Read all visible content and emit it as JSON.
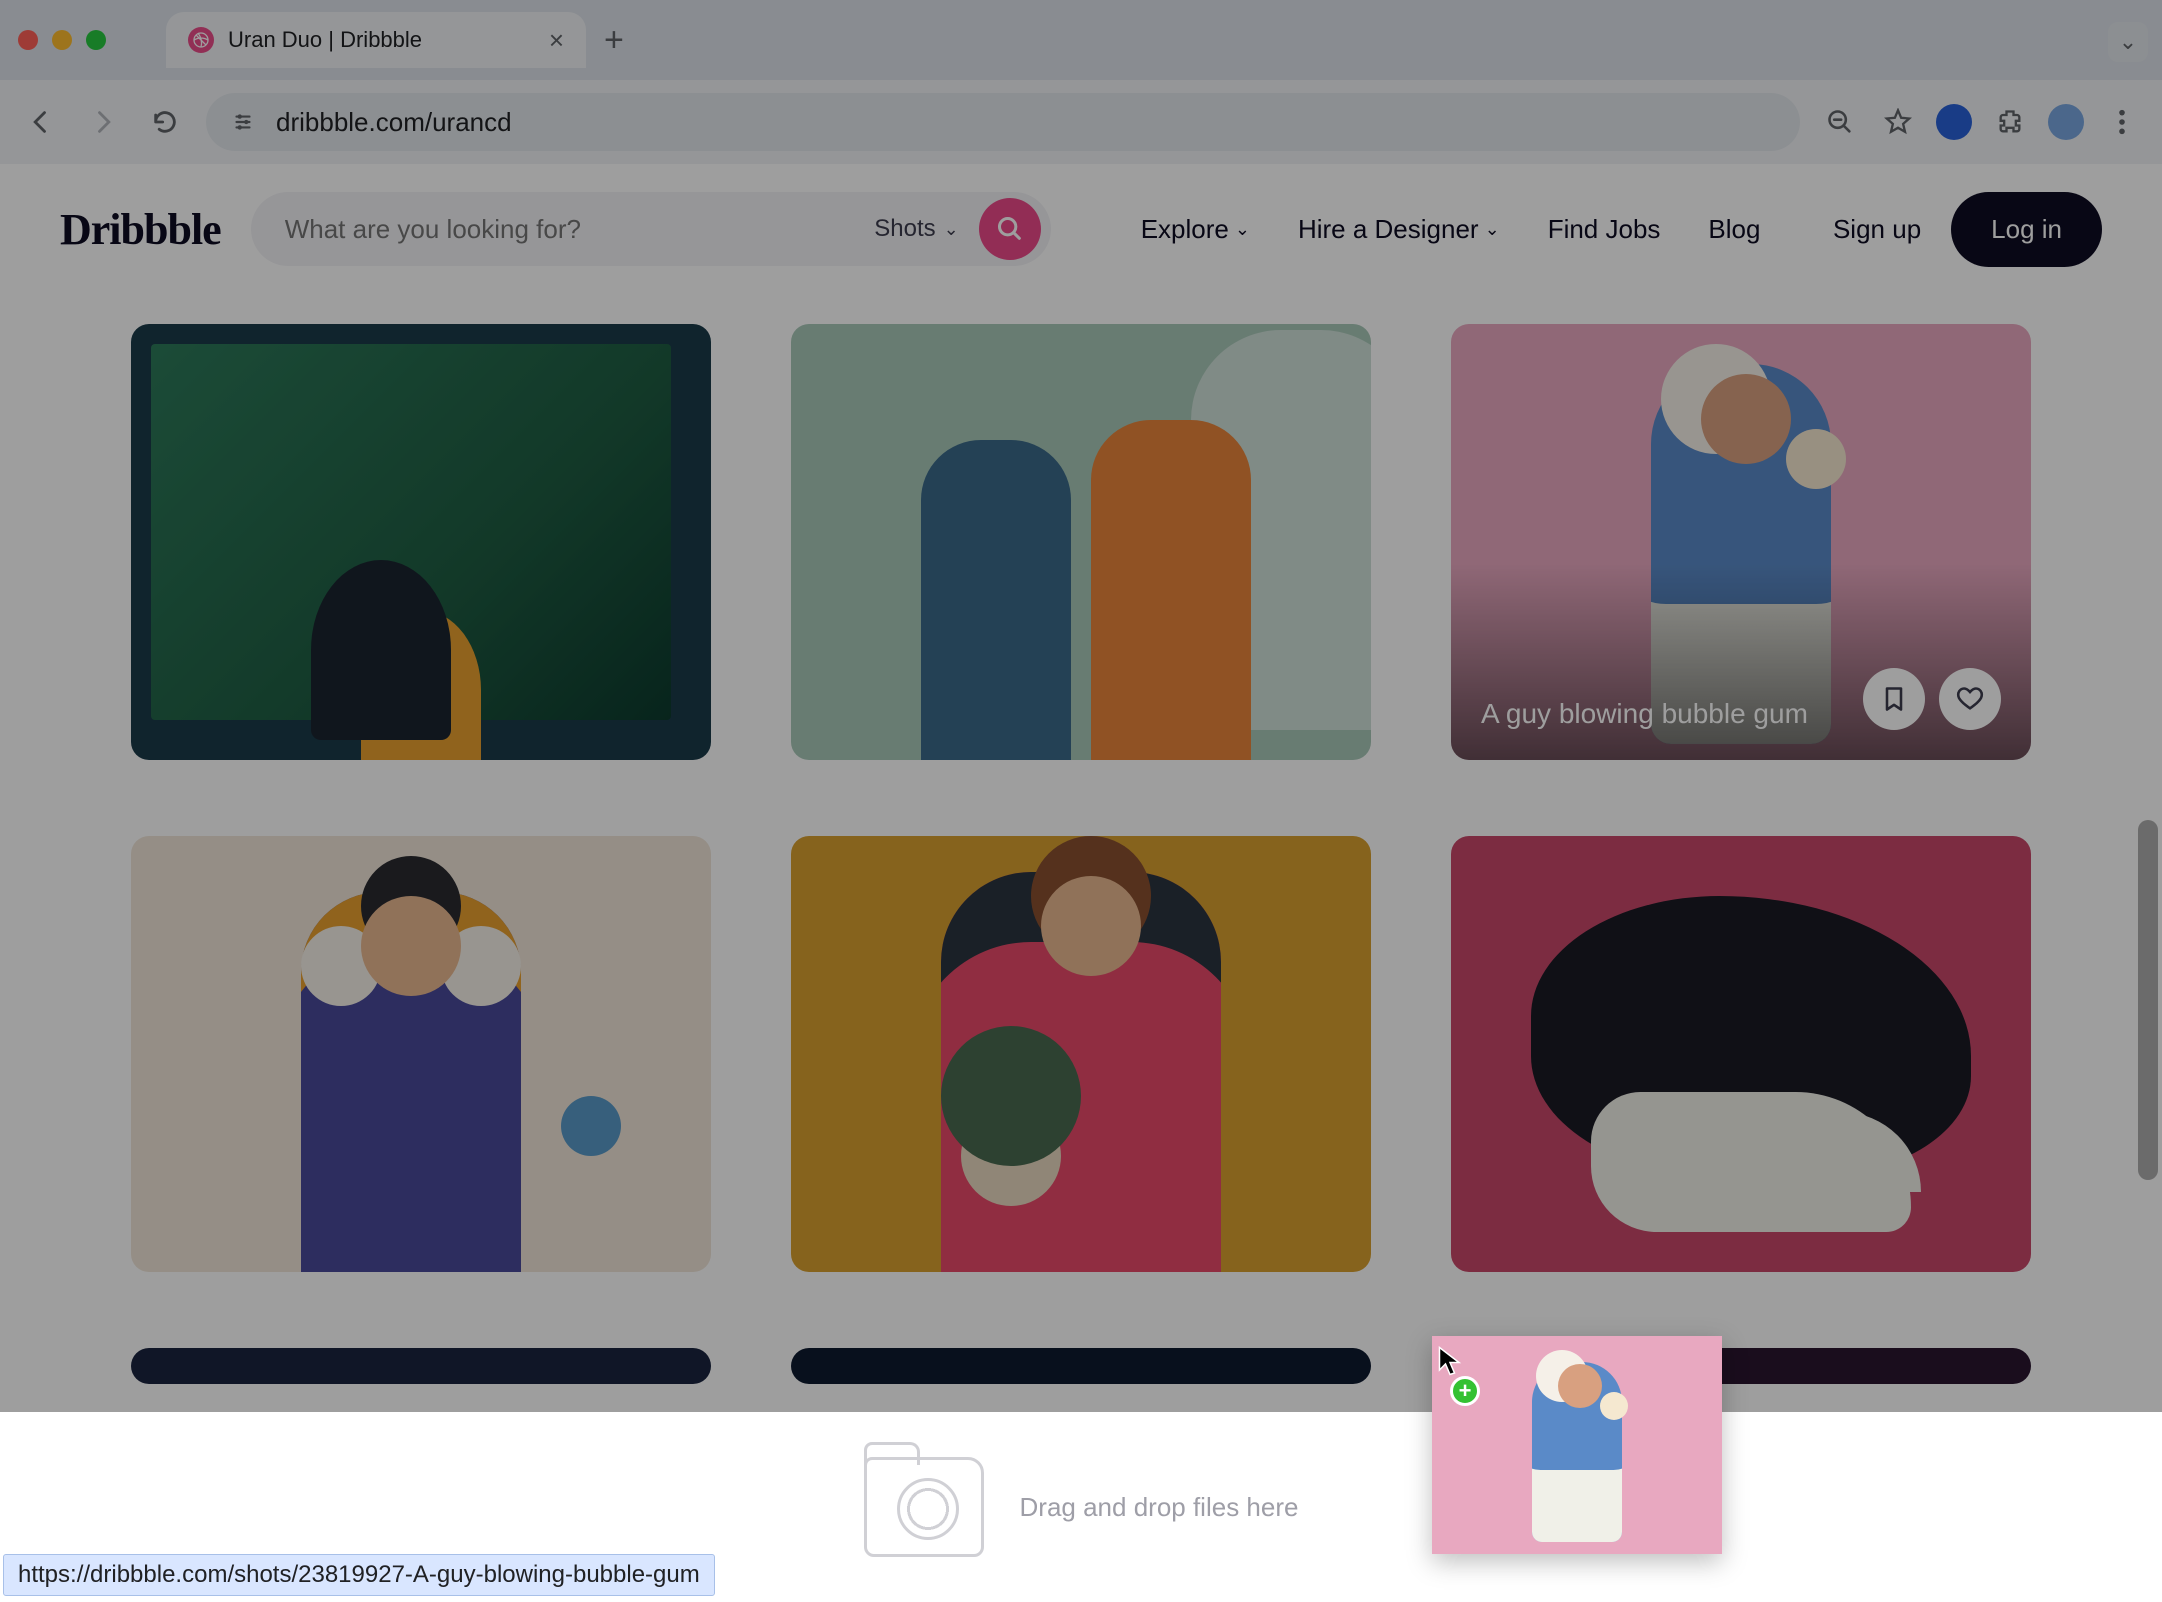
{
  "browser": {
    "tab_title": "Uran Duo | Dribbble",
    "url": "dribbble.com/urancd"
  },
  "header": {
    "logo_text": "Dribbble",
    "search_placeholder": "What are you looking for?",
    "shots_label": "Shots",
    "nav": {
      "explore": "Explore",
      "hire": "Hire a Designer",
      "jobs": "Find Jobs",
      "blog": "Blog"
    },
    "signup": "Sign up",
    "login": "Log in"
  },
  "hovered_shot": {
    "title": "A guy blowing bubble gum"
  },
  "dropbar": {
    "text": "Drag and drop files here"
  },
  "status_url": "https://dribbble.com/shots/23819927-A-guy-blowing-bubble-gum"
}
